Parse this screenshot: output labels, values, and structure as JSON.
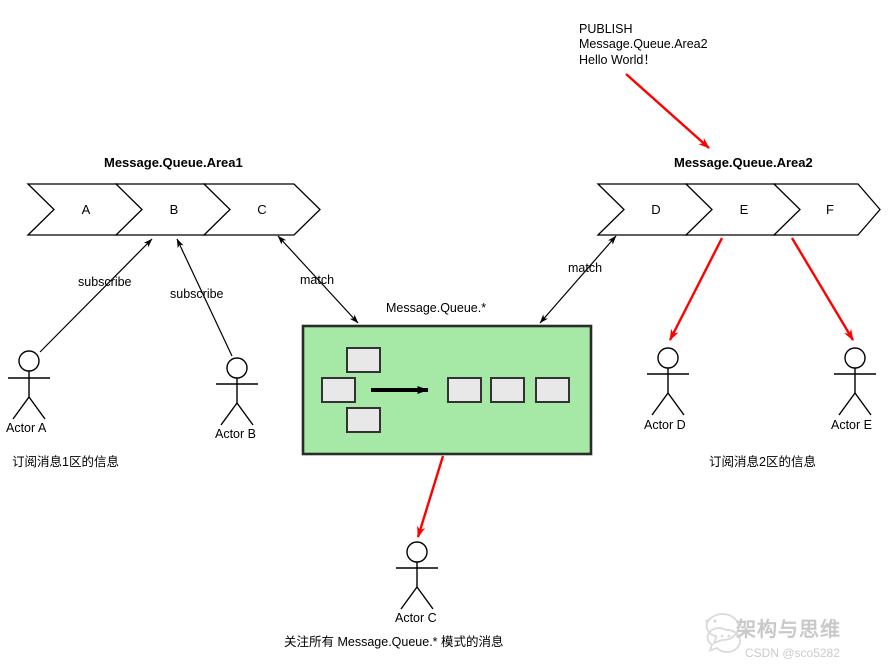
{
  "diagram": {
    "title_publish": "PUBLISH\nMessage.Queue.Area2\nHello World！",
    "queue_left": {
      "title": "Message.Queue.Area1",
      "cells": [
        "A",
        "B",
        "C"
      ]
    },
    "queue_right": {
      "title": "Message.Queue.Area2",
      "cells": [
        "D",
        "E",
        "F"
      ]
    },
    "broker": {
      "label": "Message.Queue.*",
      "fill": "#a6e8a6",
      "stroke": "#2b2b2b",
      "box_fill": "#e8e8e8",
      "box_stroke": "#333333"
    },
    "edges": {
      "subscribe_a": "subscribe",
      "subscribe_b": "subscribe",
      "match_left": "match",
      "match_right": "match"
    },
    "actors": {
      "a": "Actor A",
      "b": "Actor B",
      "c": "Actor C",
      "d": "Actor D",
      "e": "Actor E"
    },
    "captions": {
      "left": "订阅消息1区的信息",
      "right": "订阅消息2区的信息",
      "bottom": "关注所有 Message.Queue.* 模式的消息"
    },
    "colors": {
      "red_arrow": "#ff0000",
      "black_line": "#000000",
      "watermark": "#cccccc"
    }
  },
  "watermark": {
    "name": "架构与思维",
    "handle": "CSDN @sco5282"
  }
}
